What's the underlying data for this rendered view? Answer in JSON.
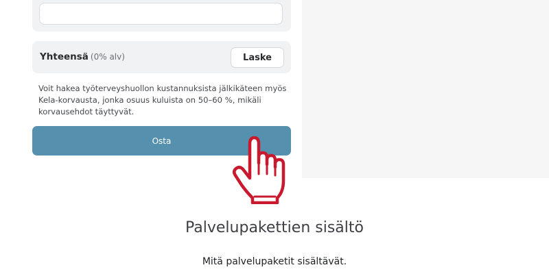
{
  "form": {
    "input_value": "",
    "total_label": "Yhteensä",
    "total_vat_note": "(0% alv)",
    "calculate_label": "Laske",
    "info_text": "Voit hakea työterveyshuollon kustannuksista jälkikäteen myös Kela-korvausta, jonka osuus kuluista on 50–60 %, mikäli korvausehdot täyttyvät.",
    "buy_label": "Osta"
  },
  "section": {
    "title": "Palvelupakettien sisältö",
    "subtitle": "Mitä palvelupaketit sisältävät."
  },
  "icons": {
    "pointer": "hand-pointer-icon"
  },
  "colors": {
    "buy_button": "#5591ae",
    "panel_bg": "#f1f2f4",
    "background_band": "#f6f6f7",
    "pointer_outline": "#c8192e"
  }
}
